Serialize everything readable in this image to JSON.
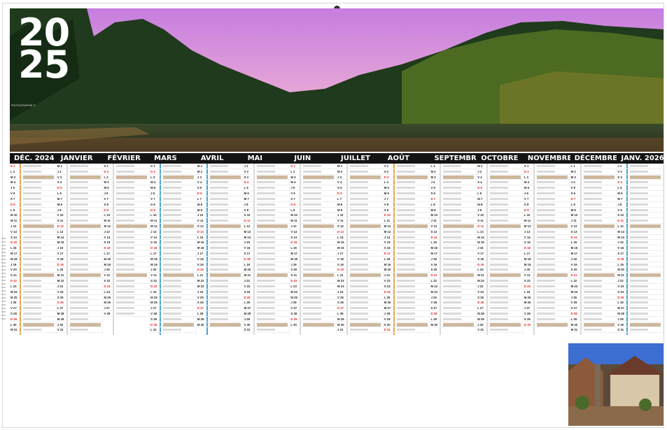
{
  "title": {
    "year_top": "20",
    "year_bottom": "25"
  },
  "hero": {
    "credit": "PHOTOGRAPHIE ©",
    "caption_line1": "",
    "caption_line2": ""
  },
  "months": [
    {
      "label": "DÉC. 2024",
      "accent": "#e6a04a",
      "days": 31
    },
    {
      "label": "JANVIER",
      "accent": "#d9d9d9",
      "days": 31
    },
    {
      "label": "FÉVRIER",
      "accent": "#d9d9d9",
      "days": 28
    },
    {
      "label": "MARS",
      "accent": "#4aa3d6",
      "days": 31
    },
    {
      "label": "AVRIL",
      "accent": "#4aa3d6",
      "days": 30
    },
    {
      "label": "MAI",
      "accent": "#d9d9d9",
      "days": 31
    },
    {
      "label": "JUIN",
      "accent": "#d9d9d9",
      "days": 30
    },
    {
      "label": "JUILLET",
      "accent": "#d9d9d9",
      "days": 31
    },
    {
      "label": "AOÛT",
      "accent": "#e6a04a",
      "days": 31
    },
    {
      "label": "SEPTEMBRE",
      "accent": "#d9d9d9",
      "days": 30
    },
    {
      "label": "OCTOBRE",
      "accent": "#d9d9d9",
      "days": 31
    },
    {
      "label": "NOVEMBRE",
      "accent": "#d9d9d9",
      "days": 30
    },
    {
      "label": "DÉCEMBRE",
      "accent": "#d9d9d9",
      "days": 31
    },
    {
      "label": "JANV. 2026",
      "accent": "#4aa3d6",
      "days": 31
    }
  ],
  "colors": {
    "header_bg": "#141414",
    "holiday": "#cdb89e",
    "sunday": "#d22222"
  },
  "icons": {
    "hanger": "hanger-hole-icon"
  }
}
